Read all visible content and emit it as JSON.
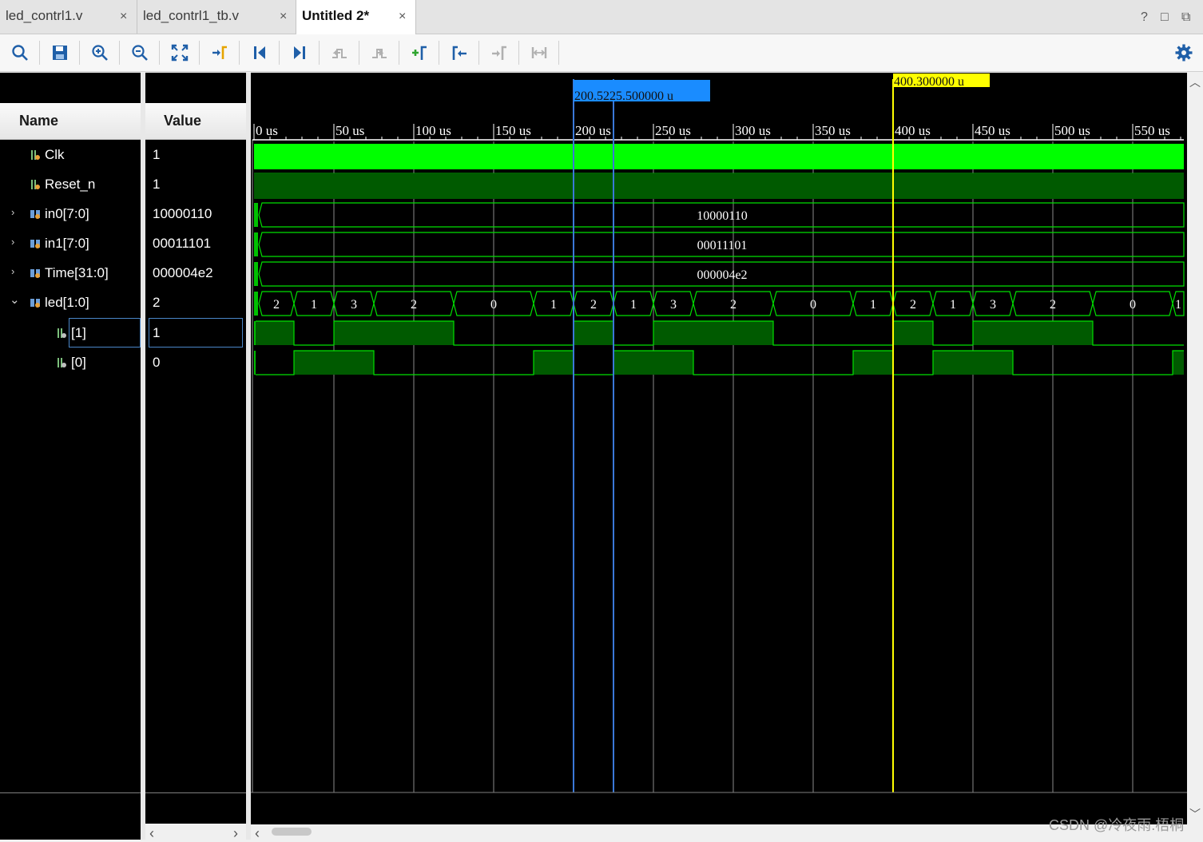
{
  "tabs": [
    {
      "label": "led_contrl1.v",
      "close": "×"
    },
    {
      "label": "led_contrl1_tb.v",
      "close": "×"
    },
    {
      "label": "Untitled 2*",
      "close": "×"
    }
  ],
  "window_controls": {
    "help": "?",
    "restore": "□",
    "popout": "⧉"
  },
  "toolbar": {
    "icons": [
      "search-icon",
      "save-icon",
      "zoom-in-icon",
      "zoom-out-icon",
      "zoom-fit-icon",
      "go-to-cursor-icon",
      "go-to-time-zero-icon",
      "go-to-last-time-icon",
      "previous-transition-icon",
      "next-transition-icon",
      "add-marker-icon",
      "previous-marker-icon",
      "next-marker-icon",
      "swap-cursors-icon"
    ],
    "settings_icon": "gear-icon"
  },
  "columns": {
    "name": "Name",
    "value": "Value"
  },
  "signals": [
    {
      "name": "Clk",
      "value": "1",
      "kind": "bit",
      "expand": ""
    },
    {
      "name": "Reset_n",
      "value": "1",
      "kind": "bit",
      "expand": ""
    },
    {
      "name": "in0[7:0]",
      "value": "10000110",
      "kind": "bus",
      "expand": "›"
    },
    {
      "name": "in1[7:0]",
      "value": "00011101",
      "kind": "bus",
      "expand": "›"
    },
    {
      "name": "Time[31:0]",
      "value": "000004e2",
      "kind": "bus",
      "expand": "›"
    },
    {
      "name": "led[1:0]",
      "value": "2",
      "kind": "bus",
      "expand": "⌄"
    },
    {
      "name": "[1]",
      "value": "1",
      "kind": "bit",
      "expand": ""
    },
    {
      "name": "[0]",
      "value": "0",
      "kind": "bit",
      "expand": ""
    }
  ],
  "ruler": {
    "ticks": [
      "0 us",
      "50 us",
      "100 us",
      "150 us",
      "200 us",
      "250 us",
      "300 us",
      "350 us",
      "400 us",
      "450 us",
      "500 us",
      "550 us"
    ]
  },
  "cursors": {
    "blue_label": "200.5225.500000 u",
    "yellow_label": "400.300000 u"
  },
  "waves": {
    "in0_value": "10000110",
    "in1_value": "00011101",
    "time_value": "000004e2",
    "led_segments": [
      {
        "start": 0,
        "end": 25,
        "label": "2"
      },
      {
        "start": 25,
        "end": 50,
        "label": "1"
      },
      {
        "start": 50,
        "end": 75,
        "label": "3"
      },
      {
        "start": 75,
        "end": 125,
        "label": "2"
      },
      {
        "start": 125,
        "end": 175,
        "label": "0"
      },
      {
        "start": 175,
        "end": 200,
        "label": "1"
      },
      {
        "start": 200,
        "end": 225,
        "label": "2"
      },
      {
        "start": 225,
        "end": 250,
        "label": "1"
      },
      {
        "start": 250,
        "end": 275,
        "label": "3"
      },
      {
        "start": 275,
        "end": 325,
        "label": "2"
      },
      {
        "start": 325,
        "end": 375,
        "label": "0"
      },
      {
        "start": 375,
        "end": 400,
        "label": "1"
      },
      {
        "start": 400,
        "end": 425,
        "label": "2"
      },
      {
        "start": 425,
        "end": 450,
        "label": "1"
      },
      {
        "start": 450,
        "end": 475,
        "label": "3"
      },
      {
        "start": 475,
        "end": 525,
        "label": "2"
      },
      {
        "start": 525,
        "end": 575,
        "label": "0"
      },
      {
        "start": 575,
        "end": 585,
        "label": "1"
      }
    ]
  },
  "watermark": "CSDN @冷夜雨.梧桐",
  "colors": {
    "wave_green": "#00ff00",
    "wave_dark_green": "#005a00",
    "cursor_blue": "#3a78d8",
    "cursor_yellow": "#ffff00",
    "toolbar_icon": "#1f5fa8"
  }
}
